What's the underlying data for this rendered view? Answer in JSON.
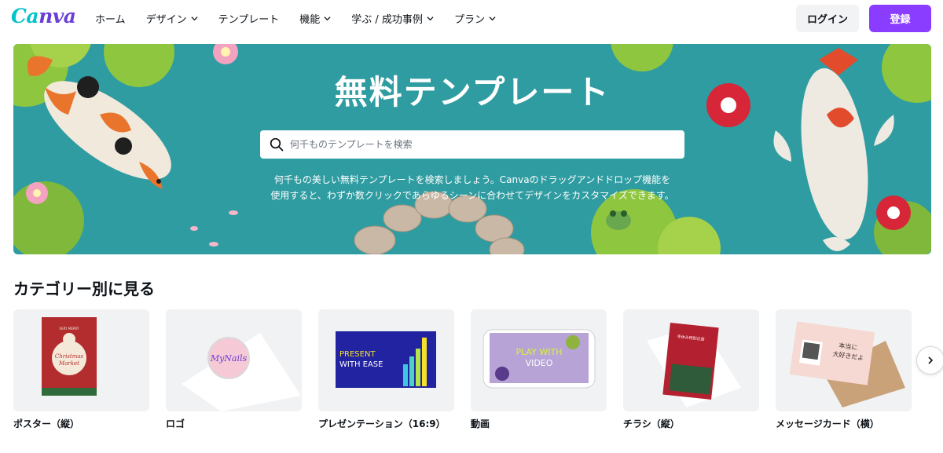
{
  "header": {
    "logo_text": "Canva",
    "nav": [
      {
        "label": "ホーム",
        "has_dropdown": false
      },
      {
        "label": "デザイン",
        "has_dropdown": true
      },
      {
        "label": "テンプレート",
        "has_dropdown": false
      },
      {
        "label": "機能",
        "has_dropdown": true
      },
      {
        "label": "学ぶ / 成功事例",
        "has_dropdown": true
      },
      {
        "label": "プラン",
        "has_dropdown": true
      }
    ],
    "login_label": "ログイン",
    "signup_label": "登録"
  },
  "hero": {
    "title": "無料テンプレート",
    "search_placeholder": "何千ものテンプレートを検索",
    "search_value": "",
    "description_line1": "何千もの美しい無料テンプレートを検索しましょう。Canvaのドラッグアンドドロップ機能を",
    "description_line2": "使用すると、わずか数クリックであらゆるシーンに合わせてデザインをカスタマイズできます。"
  },
  "categories": {
    "title": "カテゴリー別に見る",
    "items": [
      {
        "label": "ポスター（縦）",
        "thumb_text": [
          "VERY MERRY",
          "Christmas",
          "Market"
        ]
      },
      {
        "label": "ロゴ",
        "thumb_text": [
          "MyNails"
        ]
      },
      {
        "label": "プレゼンテーション（16:9）",
        "thumb_text": [
          "PRESENT",
          "WITH EASE"
        ]
      },
      {
        "label": "動画",
        "thumb_text": [
          "PLAY WITH",
          "VIDEO"
        ]
      },
      {
        "label": "チラシ（縦）",
        "thumb_text": [
          "冬休み特別企画"
        ]
      },
      {
        "label": "メッセージカード（横）",
        "thumb_text": [
          "本当に",
          "大好きだよ"
        ]
      }
    ]
  },
  "colors": {
    "brand_teal": "#00c4cc",
    "brand_purple": "#8b3dff",
    "hero_bg": "#2f9ca1"
  },
  "icons": {
    "search": "search-icon",
    "chevron": "chevron-down-icon",
    "next": "chevron-right-icon"
  }
}
